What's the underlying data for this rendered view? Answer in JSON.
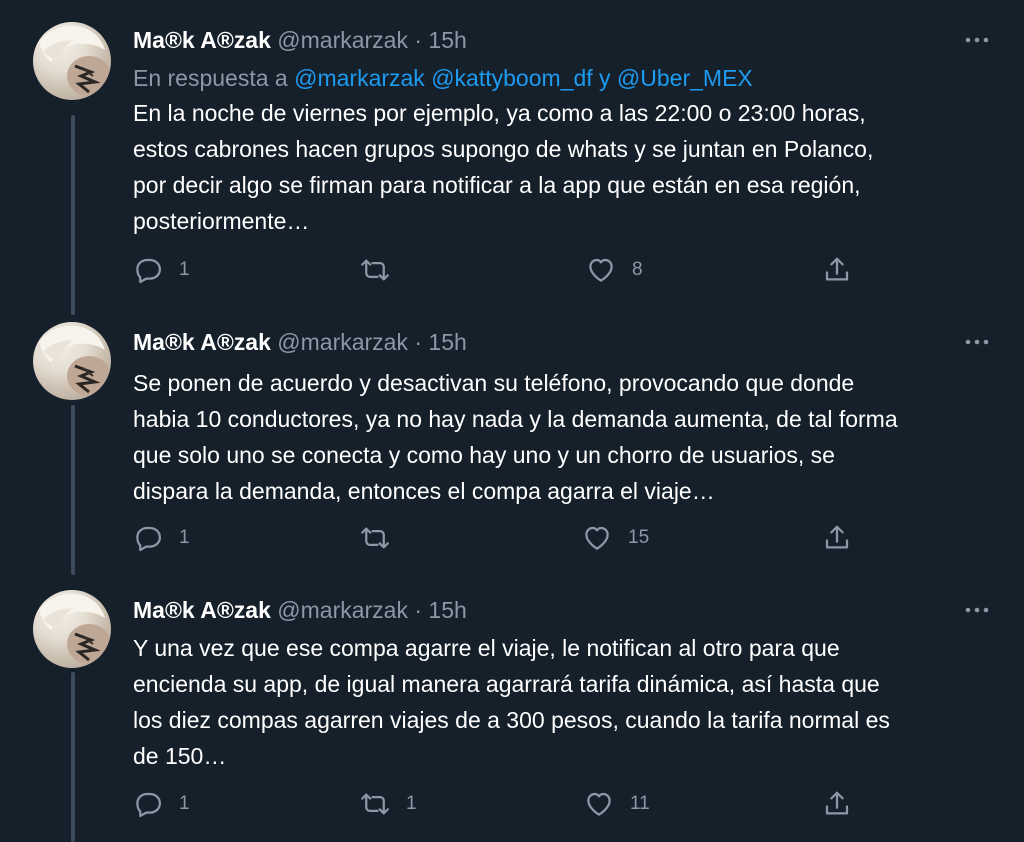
{
  "tweets": [
    {
      "name": "Ma®k A®zak",
      "handle": "@markarzak",
      "dot": "·",
      "time": "15h",
      "reply_to": {
        "prefix": "En respuesta a",
        "mentions": [
          "@markarzak",
          "@kattyboom_df",
          "@Uber_MEX"
        ],
        "conjunction": "y"
      },
      "lines": [
        "En la noche de viernes por ejemplo, ya como a las 22:00 o 23:00 horas,",
        "estos cabrones hacen grupos supongo de whats y se juntan en Polanco,",
        "por decir algo se firman para notificar a la app que están en esa región,",
        "posteriormente…"
      ],
      "replies": "1",
      "retweets": "",
      "likes": "8"
    },
    {
      "name": "Ma®k A®zak",
      "handle": "@markarzak",
      "dot": "·",
      "time": "15h",
      "lines": [
        "Se ponen de acuerdo y desactivan su teléfono, provocando que donde",
        "habia 10 conductores, ya no hay nada y la demanda aumenta, de tal forma",
        "que solo uno se conecta y como hay uno y un chorro de usuarios, se",
        "dispara la demanda, entonces el compa agarra el viaje…"
      ],
      "replies": "1",
      "retweets": "",
      "likes": "15"
    },
    {
      "name": "Ma®k A®zak",
      "handle": "@markarzak",
      "dot": "·",
      "time": "15h",
      "lines": [
        "Y una vez que ese compa agarre el viaje, le notifican al otro para que",
        "encienda su app, de igual manera agarrará tarifa dinámica, así hasta que",
        "los diez compas agarren viajes de a 300 pesos, cuando la tarifa normal es",
        "de 150…"
      ],
      "replies": "1",
      "retweets": "1",
      "likes": "11"
    }
  ],
  "icons": {
    "reply": "reply-icon",
    "retweet": "retweet-icon",
    "like": "heart-icon",
    "share": "share-icon",
    "more": "more-icon"
  },
  "colors": {
    "background": "#15202b",
    "text": "#ffffff",
    "secondary": "#8b98a5",
    "link": "#1d9bf0",
    "thread_line": "#3d4c5c"
  }
}
